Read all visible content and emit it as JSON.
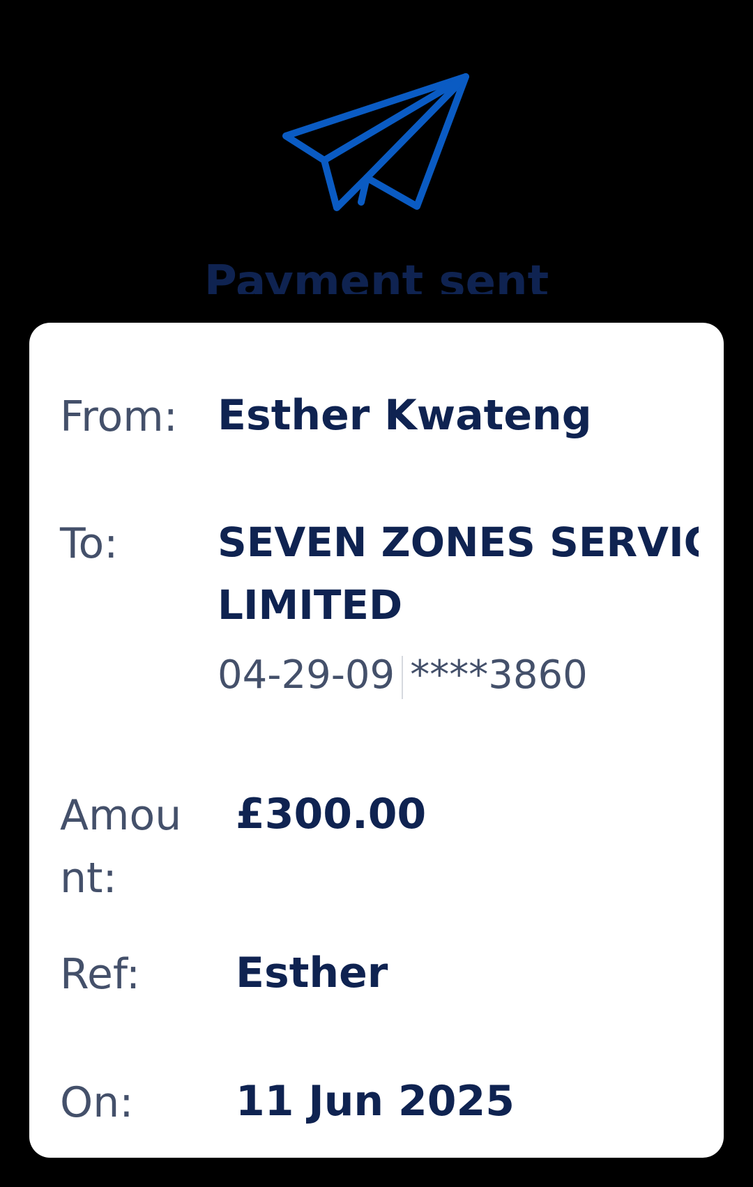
{
  "hero": {
    "icon": "paper-plane-icon",
    "icon_color": "#0a5bc3",
    "title": "Payment sent"
  },
  "details": {
    "from_label": "From:",
    "from_value": "Esther Kwateng",
    "to_label": "To:",
    "to_value_line1": "SEVEN ZONES SERVIC",
    "to_value_line2": "LIMITED",
    "sort_code": "04-29-09",
    "account_masked": "****3860",
    "amount_label": "Amount:",
    "amount_value": "£300.00",
    "ref_label": "Ref:",
    "ref_value": "Esther",
    "on_label": "On:",
    "on_value": "11 Jun 2025"
  },
  "colors": {
    "background": "#000000",
    "card": "#ffffff",
    "primary_text": "#0f2351",
    "secondary_text": "#44506a",
    "accent": "#0a5bc3"
  }
}
